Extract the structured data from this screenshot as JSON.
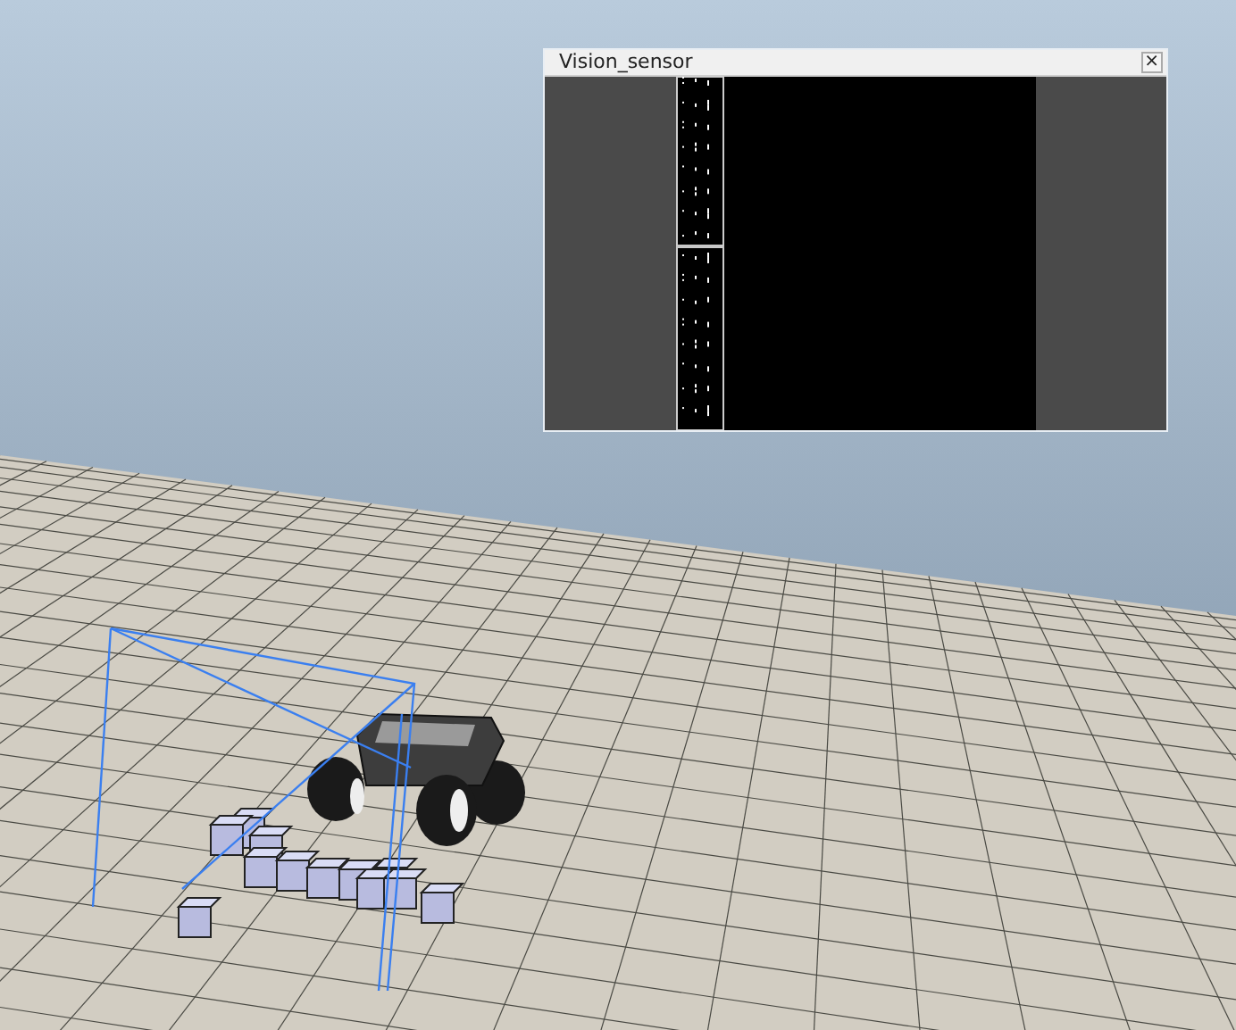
{
  "sensor_window": {
    "title": "Vision_sensor",
    "close": "×"
  }
}
